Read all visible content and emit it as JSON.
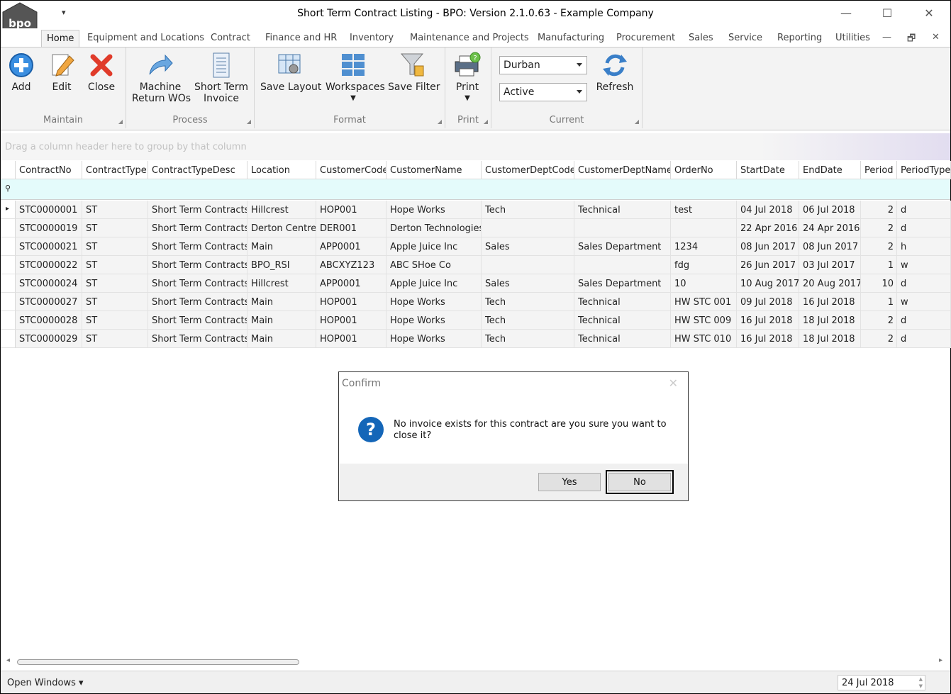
{
  "window": {
    "title": "Short Term Contract Listing - BPO: Version 2.1.0.63 - Example Company",
    "logo_text": "bpo",
    "qat_glyph": "▾",
    "min_glyph": "—",
    "max_glyph": "☐",
    "close_glyph": "✕"
  },
  "tabs": [
    {
      "label": "Home"
    },
    {
      "label": "Equipment and Locations"
    },
    {
      "label": "Contract"
    },
    {
      "label": "Finance and HR"
    },
    {
      "label": "Inventory"
    },
    {
      "label": "Maintenance and Projects"
    },
    {
      "label": "Manufacturing"
    },
    {
      "label": "Procurement"
    },
    {
      "label": "Sales"
    },
    {
      "label": "Service"
    },
    {
      "label": "Reporting"
    },
    {
      "label": "Utilities"
    }
  ],
  "mdi": {
    "min": "—",
    "restore": "🗗",
    "close": "✕"
  },
  "ribbon": {
    "maintain": {
      "label": "Maintain",
      "add": "Add",
      "edit": "Edit",
      "close": "Close"
    },
    "process": {
      "label": "Process",
      "machine1": "Machine",
      "machine2": "Return WOs",
      "sti1": "Short Term",
      "sti2": "Invoice"
    },
    "format": {
      "label": "Format",
      "save_layout": "Save Layout",
      "workspaces": "Workspaces",
      "save_filter": "Save Filter"
    },
    "print": {
      "label": "Print",
      "print": "Print"
    },
    "current": {
      "label": "Current",
      "branch": "Durban",
      "status": "Active",
      "refresh": "Refresh"
    }
  },
  "group_panel": {
    "text": "Drag a column header here to group by that column"
  },
  "grid": {
    "columns": [
      "ContractNo",
      "ContractType",
      "ContractTypeDesc",
      "Location",
      "CustomerCode",
      "CustomerName",
      "CustomerDeptCode",
      "CustomerDeptName",
      "OrderNo",
      "StartDate",
      "EndDate",
      "Period",
      "PeriodType"
    ],
    "filter_glyph": "⚲",
    "row_indicator": "▸",
    "rows": [
      [
        "STC0000001",
        "ST",
        "Short Term Contracts",
        "Hillcrest",
        "HOP001",
        "Hope Works",
        "Tech",
        "Technical",
        "test",
        "04 Jul 2018",
        "06 Jul 2018",
        "2",
        "d"
      ],
      [
        "STC0000019",
        "ST",
        "Short Term Contracts",
        "Derton Centre",
        "DER001",
        "Derton Technologies",
        "",
        "",
        "",
        "22 Apr 2016",
        "24 Apr 2016",
        "2",
        "d"
      ],
      [
        "STC0000021",
        "ST",
        "Short Term Contracts",
        "Main",
        "APP0001",
        "Apple Juice Inc",
        "Sales",
        "Sales Department",
        "1234",
        "08 Jun 2017",
        "08 Jun 2017",
        "2",
        "h"
      ],
      [
        "STC0000022",
        "ST",
        "Short Term Contracts",
        "BPO_RSI",
        "ABCXYZ123",
        "ABC SHoe Co",
        "",
        "",
        "fdg",
        "26 Jun 2017",
        "03 Jul 2017",
        "1",
        "w"
      ],
      [
        "STC0000024",
        "ST",
        "Short Term Contracts",
        "Hillcrest",
        "APP0001",
        "Apple Juice Inc",
        "Sales",
        "Sales Department",
        "10",
        "10 Aug 2017",
        "20 Aug 2017",
        "10",
        "d"
      ],
      [
        "STC0000027",
        "ST",
        "Short Term Contracts",
        "Main",
        "HOP001",
        "Hope Works",
        "Tech",
        "Technical",
        "HW STC 001",
        "09 Jul 2018",
        "16 Jul 2018",
        "1",
        "w"
      ],
      [
        "STC0000028",
        "ST",
        "Short Term Contracts",
        "Main",
        "HOP001",
        "Hope Works",
        "Tech",
        "Technical",
        "HW STC 009",
        "16 Jul 2018",
        "18 Jul 2018",
        "2",
        "d"
      ],
      [
        "STC0000029",
        "ST",
        "Short Term Contracts",
        "Main",
        "HOP001",
        "Hope Works",
        "Tech",
        "Technical",
        "HW STC 010",
        "16 Jul 2018",
        "18 Jul 2018",
        "2",
        "d"
      ]
    ]
  },
  "dialog": {
    "title": "Confirm",
    "close_glyph": "✕",
    "icon_glyph": "?",
    "message": "No invoice exists for this contract are you sure you want to close it?",
    "yes": "Yes",
    "no": "No"
  },
  "status": {
    "open_windows": "Open Windows ▾",
    "date": "24 Jul 2018",
    "scroll_left": "◂",
    "scroll_right": "▸"
  }
}
